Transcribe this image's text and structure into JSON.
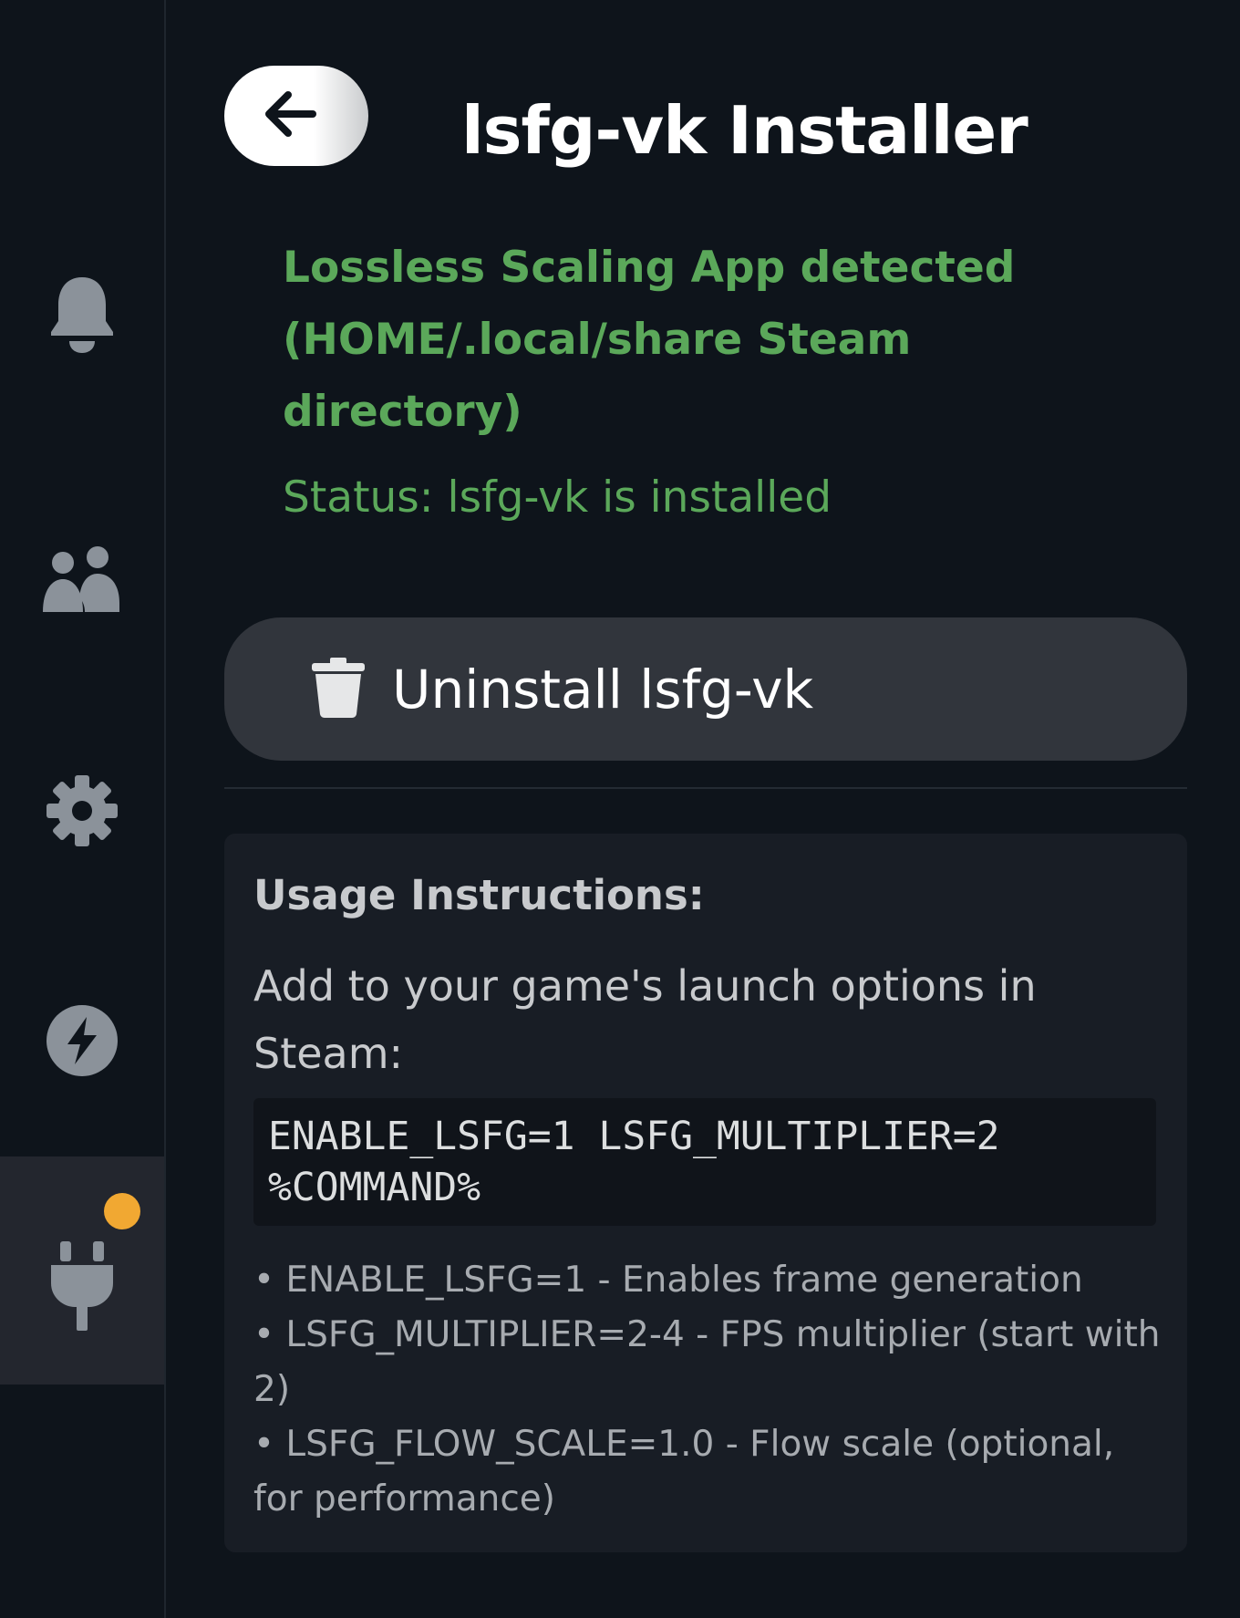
{
  "sidebar": {
    "items": [
      {
        "icon": "bell-icon",
        "label": "Notifications"
      },
      {
        "icon": "friends-icon",
        "label": "Friends"
      },
      {
        "icon": "gear-icon",
        "label": "Settings"
      },
      {
        "icon": "lightning-icon",
        "label": "Performance"
      },
      {
        "icon": "plug-icon",
        "label": "Plugins",
        "active": true,
        "has_notification": true
      }
    ],
    "notification_color": "#f1a832"
  },
  "header": {
    "back_icon": "arrow-left-icon",
    "title": "lsfg-vk Installer"
  },
  "detection": {
    "message": "Lossless Scaling App detected (HOME/.local/share Steam directory)",
    "status": "Status: lsfg-vk is installed",
    "color": "#5ba85a"
  },
  "actions": {
    "uninstall_label": "Uninstall lsfg-vk",
    "uninstall_icon": "trash-icon"
  },
  "usage": {
    "heading": "Usage Instructions:",
    "intro": "Add to your game's launch options in Steam:",
    "command": "ENABLE_LSFG=1 LSFG_MULTIPLIER=2 %COMMAND%",
    "notes": [
      "• ENABLE_LSFG=1 - Enables frame generation",
      "• LSFG_MULTIPLIER=2-4 - FPS multiplier (start with 2)",
      "• LSFG_FLOW_SCALE=1.0 - Flow scale (optional, for performance)"
    ]
  }
}
